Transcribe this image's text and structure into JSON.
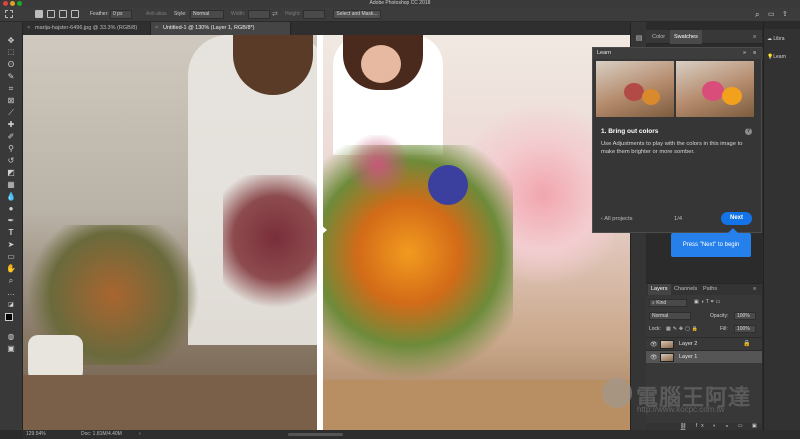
{
  "app": {
    "title": "Adobe Photoshop CC 2018"
  },
  "options_bar": {
    "feather_label": "Feather:",
    "feather_value": "0 px",
    "anti_alias_label": "Anti-alias",
    "style_label": "Style:",
    "style_value": "Normal",
    "width_label": "Width:",
    "height_label": "Height:",
    "select_mask_label": "Select and Mask..."
  },
  "document_tabs": [
    {
      "label": "marija-hajster-6496.jpg @ 33.3% (RGB/8)"
    },
    {
      "label": "Untitled-1 @ 130% (Layer 1, RGB/8*)"
    }
  ],
  "panels": {
    "color_tab": "Color",
    "swatches_tab": "Swatches",
    "libraries": "Libra",
    "learn_side": "Learn"
  },
  "learn_panel": {
    "title": "Learn",
    "step_title": "1.  Bring out colors",
    "body": "Use Adjustments to play with the colors in this image to make them brighter or more somber.",
    "back_label": "All projects",
    "progress": "1/4",
    "next_label": "Next"
  },
  "tooltip": {
    "text": "Press \"Next\" to begin"
  },
  "layers_panel": {
    "tabs": [
      "Layers",
      "Channels",
      "Paths"
    ],
    "filter_kind": "Kind",
    "blend_mode": "Normal",
    "opacity_label": "Opacity:",
    "opacity_value": "100%",
    "lock_label": "Lock:",
    "fill_label": "Fill:",
    "fill_value": "100%",
    "layers": [
      {
        "name": "Layer 2"
      },
      {
        "name": "Layer 1"
      }
    ]
  },
  "status_bar": {
    "zoom": "129.54%",
    "doc_size": "Doc: 1.81M/4.40M"
  },
  "watermark": {
    "text": "電腦王阿達",
    "url": "http://www.kocpc.com.tw"
  },
  "colors": {
    "accent": "#1473e6",
    "tooltip": "#2680eb",
    "panel_bg": "#363636"
  }
}
